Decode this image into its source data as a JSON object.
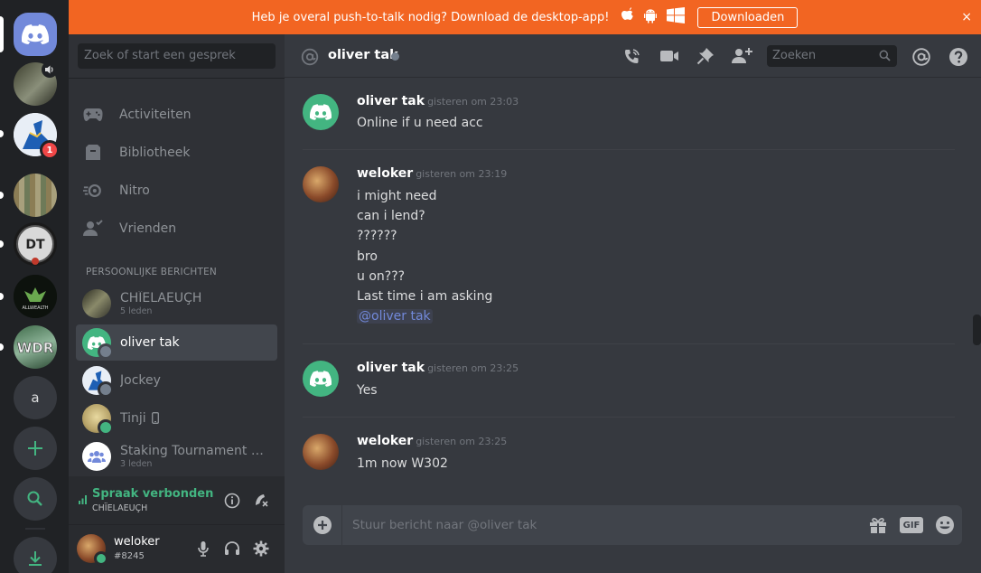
{
  "banner": {
    "text": "Heb je overal push-to-talk nodig? Download de desktop-app!",
    "download_label": "Downloaden",
    "close_glyph": "×"
  },
  "guilds": {
    "unread_badge": "1",
    "letter_server": "a"
  },
  "sidebar": {
    "search_placeholder": "Zoek of start een gesprek",
    "nav": [
      {
        "label": "Activiteiten",
        "icon": "gamepad-icon"
      },
      {
        "label": "Bibliotheek",
        "icon": "library-icon"
      },
      {
        "label": "Nitro",
        "icon": "nitro-icon"
      },
      {
        "label": "Vrienden",
        "icon": "friends-icon"
      }
    ],
    "section_title": "PERSOONLIJKE BERICHTEN",
    "dms": [
      {
        "name": "CHÏELAEUÇH",
        "sub": "5 leden"
      },
      {
        "name": "oliver tak",
        "sub": ""
      },
      {
        "name": "Jockey",
        "sub": ""
      },
      {
        "name": "Tinji",
        "sub": ""
      },
      {
        "name": "Staking Tournament Un...",
        "sub": "3 leden"
      }
    ],
    "voice": {
      "status": "Spraak verbonden",
      "channel": "CHÏELAEUÇH"
    },
    "user": {
      "name": "weloker",
      "tag": "#8245"
    }
  },
  "header": {
    "channel_name": "oliver tak",
    "search_placeholder": "Zoeken"
  },
  "messages": [
    {
      "author": "oliver tak",
      "timestamp": "gisteren om 23:03",
      "lines": [
        "Online if u need acc"
      ]
    },
    {
      "author": "weloker",
      "timestamp": "gisteren om 23:19",
      "lines": [
        "i might need",
        "can i lend?",
        "??????",
        "bro",
        "u on???",
        "Last time i am asking"
      ],
      "mention": "@oliver tak"
    },
    {
      "author": "oliver tak",
      "timestamp": "gisteren om 23:25",
      "lines": [
        "Yes"
      ]
    },
    {
      "author": "weloker",
      "timestamp": "gisteren om 23:25",
      "lines": [
        "1m now W302"
      ]
    }
  ],
  "composer": {
    "placeholder": "Stuur bericht naar @oliver tak",
    "gif_label": "GIF"
  },
  "colors": {
    "banner": "#f26522",
    "blurple": "#7289da",
    "online": "#43b581",
    "offline": "#747f8d",
    "badge": "#f04747"
  }
}
